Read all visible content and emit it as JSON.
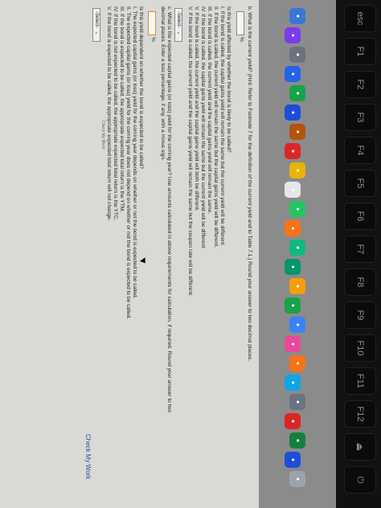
{
  "keyboard": {
    "keys": [
      "esc",
      "F1",
      "F2",
      "F3",
      "F4",
      "F5",
      "F6",
      "F7",
      "F8",
      "F9",
      "F10",
      "F11",
      "F12",
      "⏏",
      "⏻"
    ]
  },
  "dock": {
    "icons": [
      {
        "name": "finder-icon",
        "color": "#3b76d6"
      },
      {
        "name": "siri-icon",
        "color": "#7c3aed"
      },
      {
        "name": "launchpad-icon",
        "color": "#6b7280"
      },
      {
        "name": "safari-icon",
        "color": "#2563eb"
      },
      {
        "name": "chrome-icon",
        "color": "#16a34a"
      },
      {
        "name": "mail-icon",
        "color": "#1d4ed8"
      },
      {
        "name": "contacts-icon",
        "color": "#b45309"
      },
      {
        "name": "calendar-icon",
        "color": "#dc2626"
      },
      {
        "name": "notes-icon",
        "color": "#eab308"
      },
      {
        "name": "reminders-icon",
        "color": "#e5e7eb"
      },
      {
        "name": "maps-icon",
        "color": "#22c55e"
      },
      {
        "name": "photos-icon",
        "color": "#f97316"
      },
      {
        "name": "messages-icon",
        "color": "#10b981"
      },
      {
        "name": "facetime-icon",
        "color": "#059669"
      },
      {
        "name": "pages-icon",
        "color": "#f59e0b"
      },
      {
        "name": "numbers-icon",
        "color": "#16a34a"
      },
      {
        "name": "keynote-icon",
        "color": "#3b82f6"
      },
      {
        "name": "itunes-icon",
        "color": "#ec4899"
      },
      {
        "name": "ibooks-icon",
        "color": "#f97316"
      },
      {
        "name": "app-store-icon",
        "color": "#0ea5e9"
      },
      {
        "name": "system-preferences-icon",
        "color": "#6b7280"
      },
      {
        "name": "powerpoint-icon",
        "color": "#dc2626"
      },
      {
        "name": "excel-icon",
        "color": "#15803d"
      },
      {
        "name": "word-icon",
        "color": "#1d4ed8"
      },
      {
        "name": "trash-icon",
        "color": "#9ca3af"
      }
    ]
  },
  "page": {
    "question_b": "b. What is the current yield? (Hint: Refer to Footnote 7 for the definition of the current yield and to Table 7.1.) Round your answer to two decimal places.",
    "percent_unit_1": "%",
    "affected_question": "Is this yield affected by whether the bond is likely to be called?",
    "options_1": [
      "I.   If the bond is called, the capital gains yield will remain the same but the current yield will be different.",
      "II.  If the bond is called, the current yield will remain the same but the capital gains yield will be different.",
      "III. If the bond is called, the current yield and the capital gains yield will remain the same.",
      "IV.  If the bond is called, the capital gains yield will remain the same but the current yield will be different.",
      "V.   If the bond is called, the current yield and the capital gains yield will both be different."
    ],
    "option_1_last": "V.   If the bond is called, the current yield and the capital gains yield will remain the same but the coupon rate will be different.",
    "select_label_1": "-Select-",
    "question_c_line1": "c. What is the expected capital gains (or loss) yield for the coming year? Use amounts calculated in above requirements for calculation, if required. Round your answer to two",
    "question_c_line2": "decimal places. Enter a loss percentage, if any, with a minus sign.",
    "percent_unit_2": "%",
    "dependent_question": "Is this yield dependent on whether the bond is expected to be called?",
    "options_2": [
      "I.   The expected capital gains (or loss) yield for the coming year depends on whether or not the bond is expected to be called.",
      "II.  The expected capital gains (or loss) yield for the coming year does not depend on whether or not the bond is expected to be called.",
      "III. If the bond is expected to be called, the appropriate expected total return is the YTM.",
      "IV.  If the bond is not expected to be called, the appropriate expected total return is the YTC.",
      "V.   If the bond is expected to be called, the appropriate expected total return will not change."
    ],
    "select_label_2": "-Select-",
    "check_my_work": "Check My Work",
    "check_my_work_small": "Check My Work"
  }
}
